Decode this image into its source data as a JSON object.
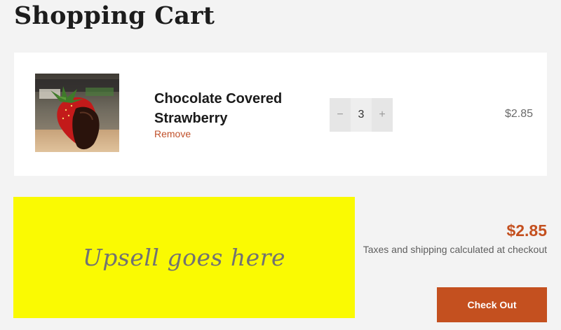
{
  "page": {
    "title": "Shopping Cart"
  },
  "cart": {
    "items": [
      {
        "title": "Chocolate Covered Strawberry",
        "remove_label": "Remove",
        "quantity": "3",
        "decrease_label": "−",
        "increase_label": "+",
        "price": "$2.85",
        "image_alt": "chocolate-covered-strawberry-photo"
      }
    ]
  },
  "upsell": {
    "text": "Upsell goes here",
    "background": "#fafa02"
  },
  "summary": {
    "subtotal": "$2.85",
    "tax_note": "Taxes and shipping calculated at checkout",
    "checkout_label": "Check Out"
  },
  "colors": {
    "accent": "#c4501f",
    "remove_link": "#c0502a",
    "page_background": "#f3f3f3"
  }
}
